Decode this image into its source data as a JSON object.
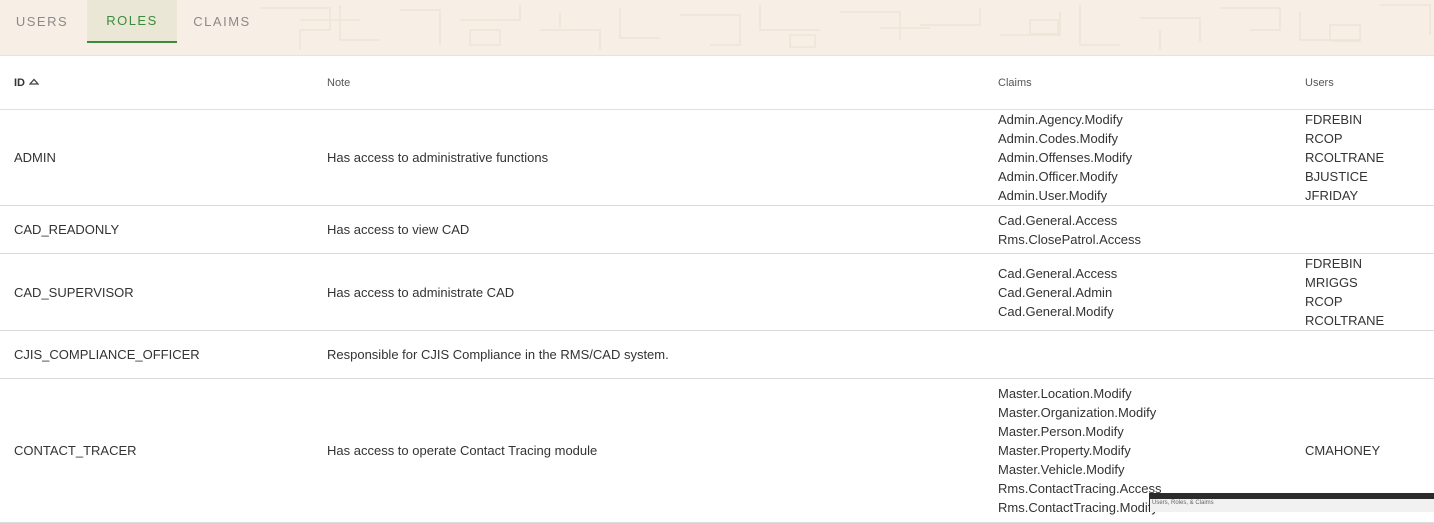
{
  "tabs": [
    {
      "label": "USERS",
      "active": false
    },
    {
      "label": "ROLES",
      "active": true
    },
    {
      "label": "CLAIMS",
      "active": false
    }
  ],
  "colors": {
    "accent": "#3c8b3c",
    "tab_bar_bg": "#f7efe5",
    "row_divider": "#dcdcdc"
  },
  "table": {
    "headers": {
      "id": "ID",
      "note": "Note",
      "claims": "Claims",
      "users": "Users"
    },
    "sort": {
      "column": "id",
      "direction": "ascending",
      "icon": "sort-up-icon"
    },
    "rows": [
      {
        "id": "ADMIN",
        "note": "Has access to administrative functions",
        "claims": [
          "Admin.Agency.Modify",
          "Admin.Codes.Modify",
          "Admin.Offenses.Modify",
          "Admin.Officer.Modify",
          "Admin.User.Modify"
        ],
        "users": [
          "FDREBIN",
          "RCOP",
          "RCOLTRANE",
          "BJUSTICE",
          "JFRIDAY"
        ]
      },
      {
        "id": "CAD_READONLY",
        "note": "Has access to view CAD",
        "claims": [
          "Cad.General.Access",
          "Rms.ClosePatrol.Access"
        ],
        "users": []
      },
      {
        "id": "CAD_SUPERVISOR",
        "note": "Has access to administrate CAD",
        "claims": [
          "Cad.General.Access",
          "Cad.General.Admin",
          "Cad.General.Modify"
        ],
        "users": [
          "FDREBIN",
          "MRIGGS",
          "RCOP",
          "RCOLTRANE"
        ]
      },
      {
        "id": "CJIS_COMPLIANCE_OFFICER",
        "note": "Responsible for CJIS Compliance in the RMS/CAD system.",
        "claims": [],
        "users": []
      },
      {
        "id": "CONTACT_TRACER",
        "note": "Has access to operate Contact Tracing module",
        "claims": [
          "Master.Location.Modify",
          "Master.Organization.Modify",
          "Master.Person.Modify",
          "Master.Property.Modify",
          "Master.Vehicle.Modify",
          "Rms.ContactTracing.Access",
          "Rms.ContactTracing.Modify"
        ],
        "users": [
          "CMAHONEY"
        ]
      }
    ]
  },
  "tooltip": {
    "text": "Users, Roles, & Claims"
  }
}
